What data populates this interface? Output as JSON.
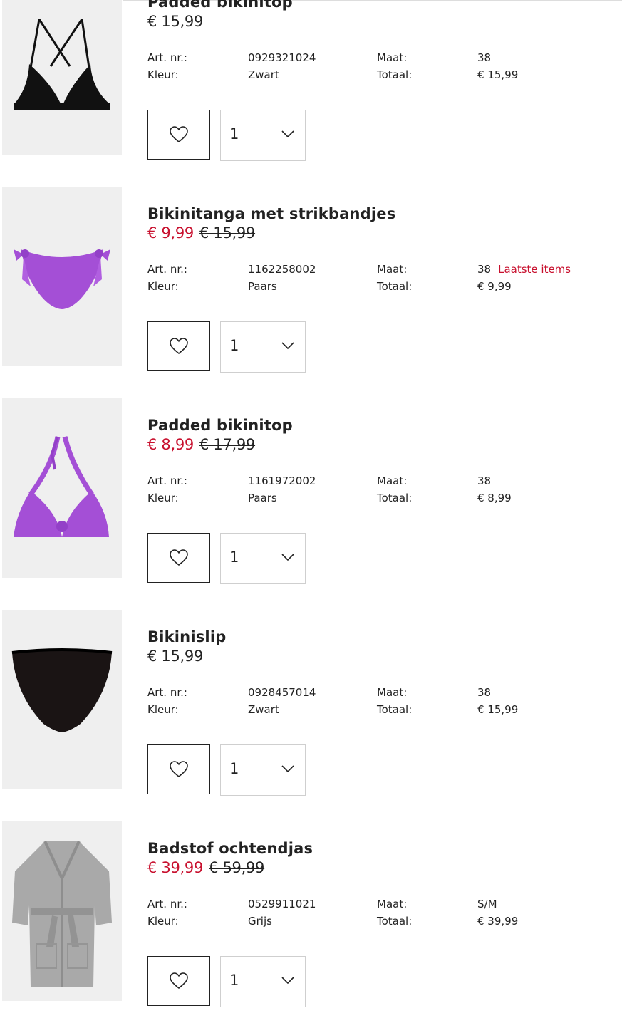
{
  "labels": {
    "art_nr": "Art. nr.:",
    "kleur": "Kleur:",
    "maat": "Maat:",
    "totaal": "Totaal:"
  },
  "items": [
    {
      "name": "Padded bikinitop",
      "price": "€ 15,99",
      "sale_price": "",
      "old_price": "",
      "art_nr": "0929321024",
      "kleur": "Zwart",
      "maat": "38",
      "stock_note": "",
      "totaal": "€ 15,99",
      "quantity": "1",
      "image": "black-triangle-bikini-top"
    },
    {
      "name": "Bikinitanga met strikbandjes",
      "price": "",
      "sale_price": "€ 9,99",
      "old_price": "€ 15,99",
      "art_nr": "1162258002",
      "kleur": "Paars",
      "maat": "38",
      "stock_note": "Laatste items",
      "totaal": "€ 9,99",
      "quantity": "1",
      "image": "purple-tie-side-bikini-bottom"
    },
    {
      "name": "Padded bikinitop",
      "price": "",
      "sale_price": "€ 8,99",
      "old_price": "€ 17,99",
      "art_nr": "1161972002",
      "kleur": "Paars",
      "maat": "38",
      "stock_note": "",
      "totaal": "€ 8,99",
      "quantity": "1",
      "image": "purple-halter-bikini-top"
    },
    {
      "name": "Bikinislip",
      "price": "€ 15,99",
      "sale_price": "",
      "old_price": "",
      "art_nr": "0928457014",
      "kleur": "Zwart",
      "maat": "38",
      "stock_note": "",
      "totaal": "€ 15,99",
      "quantity": "1",
      "image": "black-high-waist-bikini-bottom"
    },
    {
      "name": "Badstof ochtendjas",
      "price": "",
      "sale_price": "€ 39,99",
      "old_price": "€ 59,99",
      "art_nr": "0529911021",
      "kleur": "Grijs",
      "maat": "S/M",
      "stock_note": "",
      "totaal": "€ 39,99",
      "quantity": "1",
      "image": "grey-terry-bathrobe"
    }
  ],
  "colors": {
    "sale": "#c8102e",
    "text": "#222222",
    "image_bg": "#efefef",
    "border_light": "#cfcfcf"
  },
  "icons": {
    "favorite": "heart-icon",
    "dropdown": "chevron-down-icon"
  }
}
